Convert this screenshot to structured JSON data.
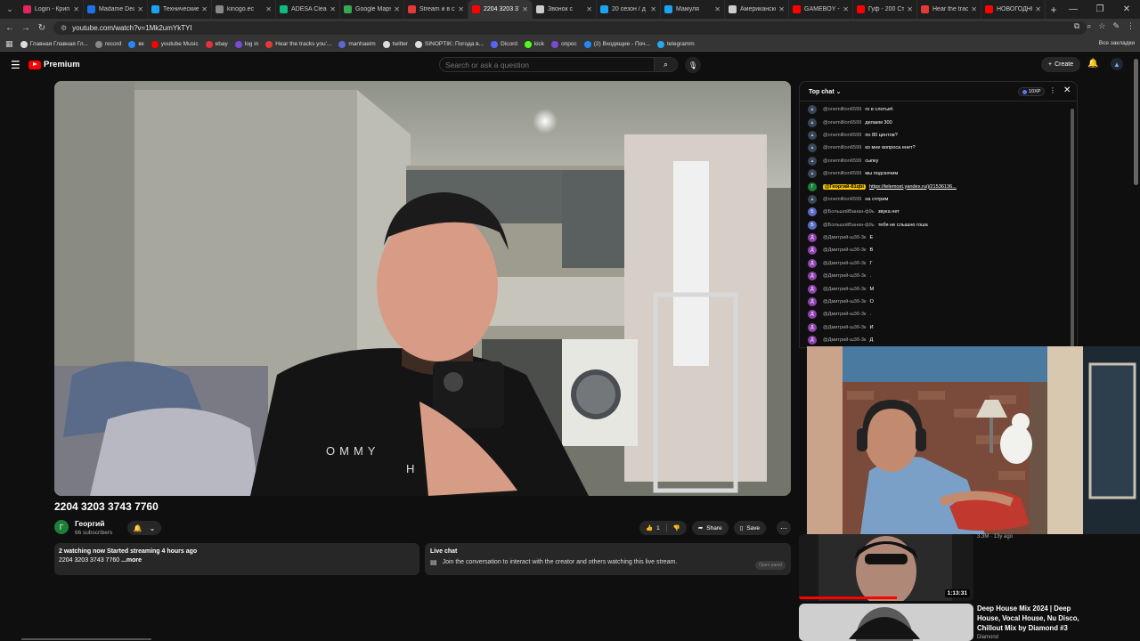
{
  "browser": {
    "tabs": [
      {
        "label": "Login - Крип",
        "color": "#e0245e"
      },
      {
        "label": "Madame Dea",
        "color": "#1a73e8"
      },
      {
        "label": "Технические",
        "color": "#1da1f2"
      },
      {
        "label": "kinogo.ec",
        "color": "#888888"
      },
      {
        "label": "ADESA Clear",
        "color": "#10b981"
      },
      {
        "label": "Google Maps",
        "color": "#34a853"
      },
      {
        "label": "Stream и в сп",
        "color": "#e53935"
      },
      {
        "label": "2204 3203 37",
        "color": "#ff0000"
      },
      {
        "label": "Звонок с",
        "color": "#cccccc"
      },
      {
        "label": "20 сезон / д",
        "color": "#1da1f2"
      },
      {
        "label": "Мамуля",
        "color": "#1da1f2"
      },
      {
        "label": "Американско",
        "color": "#cccccc"
      },
      {
        "label": "GAMEBOY -",
        "color": "#ff0000"
      },
      {
        "label": "Гуф - 200 Ст",
        "color": "#ff0000"
      },
      {
        "label": "Hear the trac",
        "color": "#e53935"
      },
      {
        "label": "НОВОГОДНИ",
        "color": "#ff0000"
      }
    ],
    "url": "youtube.com/watch?v=1Mk2umYkTYI",
    "bookmarks": [
      {
        "label": "Главная Главная Гл...",
        "color": "#dddddd"
      },
      {
        "label": "record",
        "color": "#888888"
      },
      {
        "label": "вк",
        "color": "#2787f5"
      },
      {
        "label": "youtube Music",
        "color": "#ff0000"
      },
      {
        "label": "ebay",
        "color": "#e53238"
      },
      {
        "label": "log in",
        "color": "#7b4bd6"
      },
      {
        "label": "Hear the tracks you'...",
        "color": "#e53935"
      },
      {
        "label": "manhaeim",
        "color": "#5a6ad1"
      },
      {
        "label": "twitter",
        "color": "#dddddd"
      },
      {
        "label": "SINOPTIK: Погода в...",
        "color": "#dddddd"
      },
      {
        "label": "Dicord",
        "color": "#5865f2"
      },
      {
        "label": "kick",
        "color": "#53fc18"
      },
      {
        "label": "опрос",
        "color": "#7b4bd6"
      },
      {
        "label": "(2) Входящие - Поч...",
        "color": "#2787f5"
      },
      {
        "label": "telegramm",
        "color": "#29a9eb"
      }
    ],
    "all_bookmarks": "Все закладки"
  },
  "youtube": {
    "logo_text": "Premium",
    "search_placeholder": "Search or ask a question",
    "create_label": "Create"
  },
  "video": {
    "title": "2204 3203 3743 7760",
    "channel": "Георгий",
    "channel_initial": "Г",
    "subscribers": "66 subscribers",
    "likes": "1",
    "share_label": "Share",
    "save_label": "Save",
    "watching": "2 watching now  Started streaming 4 hours ago",
    "description": "2204 3203 3743 7760",
    "more_label": "...more"
  },
  "live_chat_box": {
    "title": "Live chat",
    "text": "Join the conversation to interact with the creator and others watching this live stream.",
    "open_panel": "Open panel"
  },
  "chat": {
    "mode": "Top chat",
    "xp": "10XP",
    "messages": [
      {
        "author": "@onemillion6599",
        "text": "го в слотыя\\",
        "avatar_color": "#3a4656",
        "initial": "",
        "highlight": false
      },
      {
        "author": "@onemillion6599",
        "text": "делаем 300",
        "avatar_color": "#3a4656",
        "initial": "",
        "highlight": false
      },
      {
        "author": "@onemillion6599",
        "text": "по 80 центов?",
        "avatar_color": "#3a4656",
        "initial": "",
        "highlight": false
      },
      {
        "author": "@onemillion6599",
        "text": "ко мне вопроса енет?",
        "avatar_color": "#3a4656",
        "initial": "",
        "highlight": false
      },
      {
        "author": "@onemillion6599",
        "text": "сыпку",
        "avatar_color": "#3a4656",
        "initial": "",
        "highlight": false
      },
      {
        "author": "@onemillion6599",
        "text": "мы подскочим",
        "avatar_color": "#3a4656",
        "initial": "",
        "highlight": false
      },
      {
        "author": "@Георгий-81qbi",
        "text": "https://telemost.yandex.ru/j/21536136...",
        "avatar_color": "#1c7f38",
        "initial": "Г",
        "highlight": true
      },
      {
        "author": "@onemillion6599",
        "text": "на счтрим",
        "avatar_color": "#3a4656",
        "initial": "",
        "highlight": false
      },
      {
        "author": "@БольшойБанан-ф9ь",
        "text": "звука нет",
        "avatar_color": "#5c6bc0",
        "initial": "Б",
        "highlight": false
      },
      {
        "author": "@БольшойБанан-ф9ь",
        "text": "тебя не слышно гоша",
        "avatar_color": "#5c6bc0",
        "initial": "Б",
        "highlight": false
      },
      {
        "author": "@Дмитрий-ш3б-3к",
        "text": "Е",
        "avatar_color": "#8e44ad",
        "initial": "Д",
        "highlight": false
      },
      {
        "author": "@Дмитрий-ш3б-3к",
        "text": "В",
        "avatar_color": "#8e44ad",
        "initial": "Д",
        "highlight": false
      },
      {
        "author": "@Дмитрий-ш3б-3к",
        "text": "Г",
        "avatar_color": "#8e44ad",
        "initial": "Д",
        "highlight": false
      },
      {
        "author": "@Дмитрий-ш3б-3к",
        "text": ".",
        "avatar_color": "#8e44ad",
        "initial": "Д",
        "highlight": false
      },
      {
        "author": "@Дмитрий-ш3б-3к",
        "text": "М",
        "avatar_color": "#8e44ad",
        "initial": "Д",
        "highlight": false
      },
      {
        "author": "@Дмитрий-ш3б-3к",
        "text": "О",
        "avatar_color": "#8e44ad",
        "initial": "Д",
        "highlight": false
      },
      {
        "author": "@Дмитрий-ш3б-3к",
        "text": ".",
        "avatar_color": "#8e44ad",
        "initial": "Д",
        "highlight": false
      },
      {
        "author": "@Дмитрий-ш3б-3к",
        "text": "И",
        "avatar_color": "#8e44ad",
        "initial": "Д",
        "highlight": false
      },
      {
        "author": "@Дмитрий-ш3б-3к",
        "text": "Д",
        "avatar_color": "#8e44ad",
        "initial": "Д",
        "highlight": false
      }
    ]
  },
  "recommendations": {
    "top_meta": "3.3M · 13y ago",
    "first_duration": "1:13:31",
    "second_title": "Deep House Mix 2024 | Deep House, Vocal House, Nu Disco, Chillout Mix by Diamond #3",
    "second_channel": "Diamond"
  }
}
